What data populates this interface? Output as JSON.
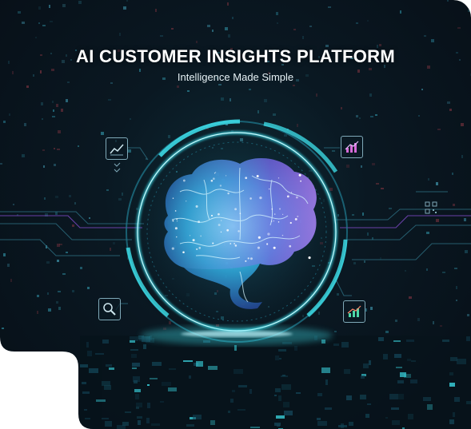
{
  "header": {
    "title": "AI CUSTOMER INSIGHTS PLATFORM",
    "subtitle": "Intelligence Made Simple"
  },
  "icons": [
    {
      "name": "line-chart-icon"
    },
    {
      "name": "bar-chart-icon"
    },
    {
      "name": "magnifier-icon"
    },
    {
      "name": "growth-chart-icon"
    },
    {
      "name": "qr-code-icon"
    },
    {
      "name": "brain-icon"
    }
  ],
  "colors": {
    "background": "#070f17",
    "accent_cyan": "#3fe3ee",
    "accent_purple": "#b06bf0",
    "text": "#ffffff"
  }
}
